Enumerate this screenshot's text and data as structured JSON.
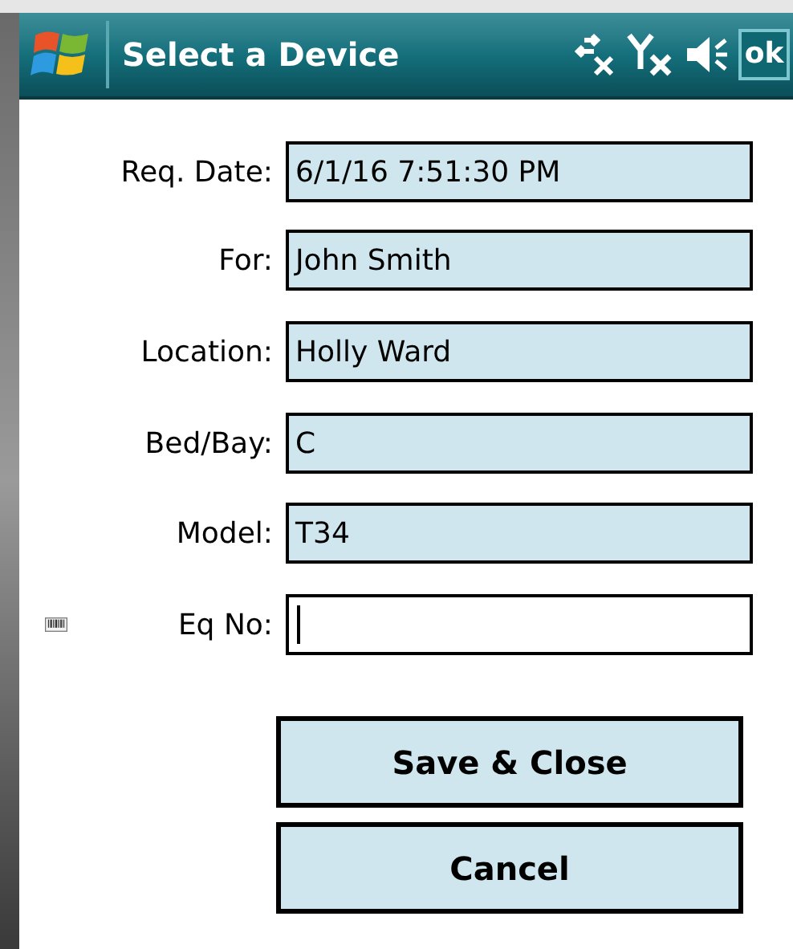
{
  "window": {
    "title": "Select a Device",
    "ok_button": "ok"
  },
  "fields": [
    {
      "label": "Req. Date:",
      "value": "6/1/16 7:51:30 PM",
      "readonly": true,
      "focused": false,
      "scanner": false
    },
    {
      "label": "For:",
      "value": "John Smith",
      "readonly": true,
      "focused": false,
      "scanner": false
    },
    {
      "label": "Location:",
      "value": "Holly Ward",
      "readonly": true,
      "focused": false,
      "scanner": false
    },
    {
      "label": "Bed/Bay:",
      "value": "C",
      "readonly": true,
      "focused": false,
      "scanner": false
    },
    {
      "label": "Model:",
      "value": "T34",
      "readonly": true,
      "focused": false,
      "scanner": false
    },
    {
      "label": "Eq No:",
      "readonly": false,
      "focused": true,
      "scanner": true
    }
  ],
  "buttons": [
    "Save & Close",
    "Cancel"
  ]
}
